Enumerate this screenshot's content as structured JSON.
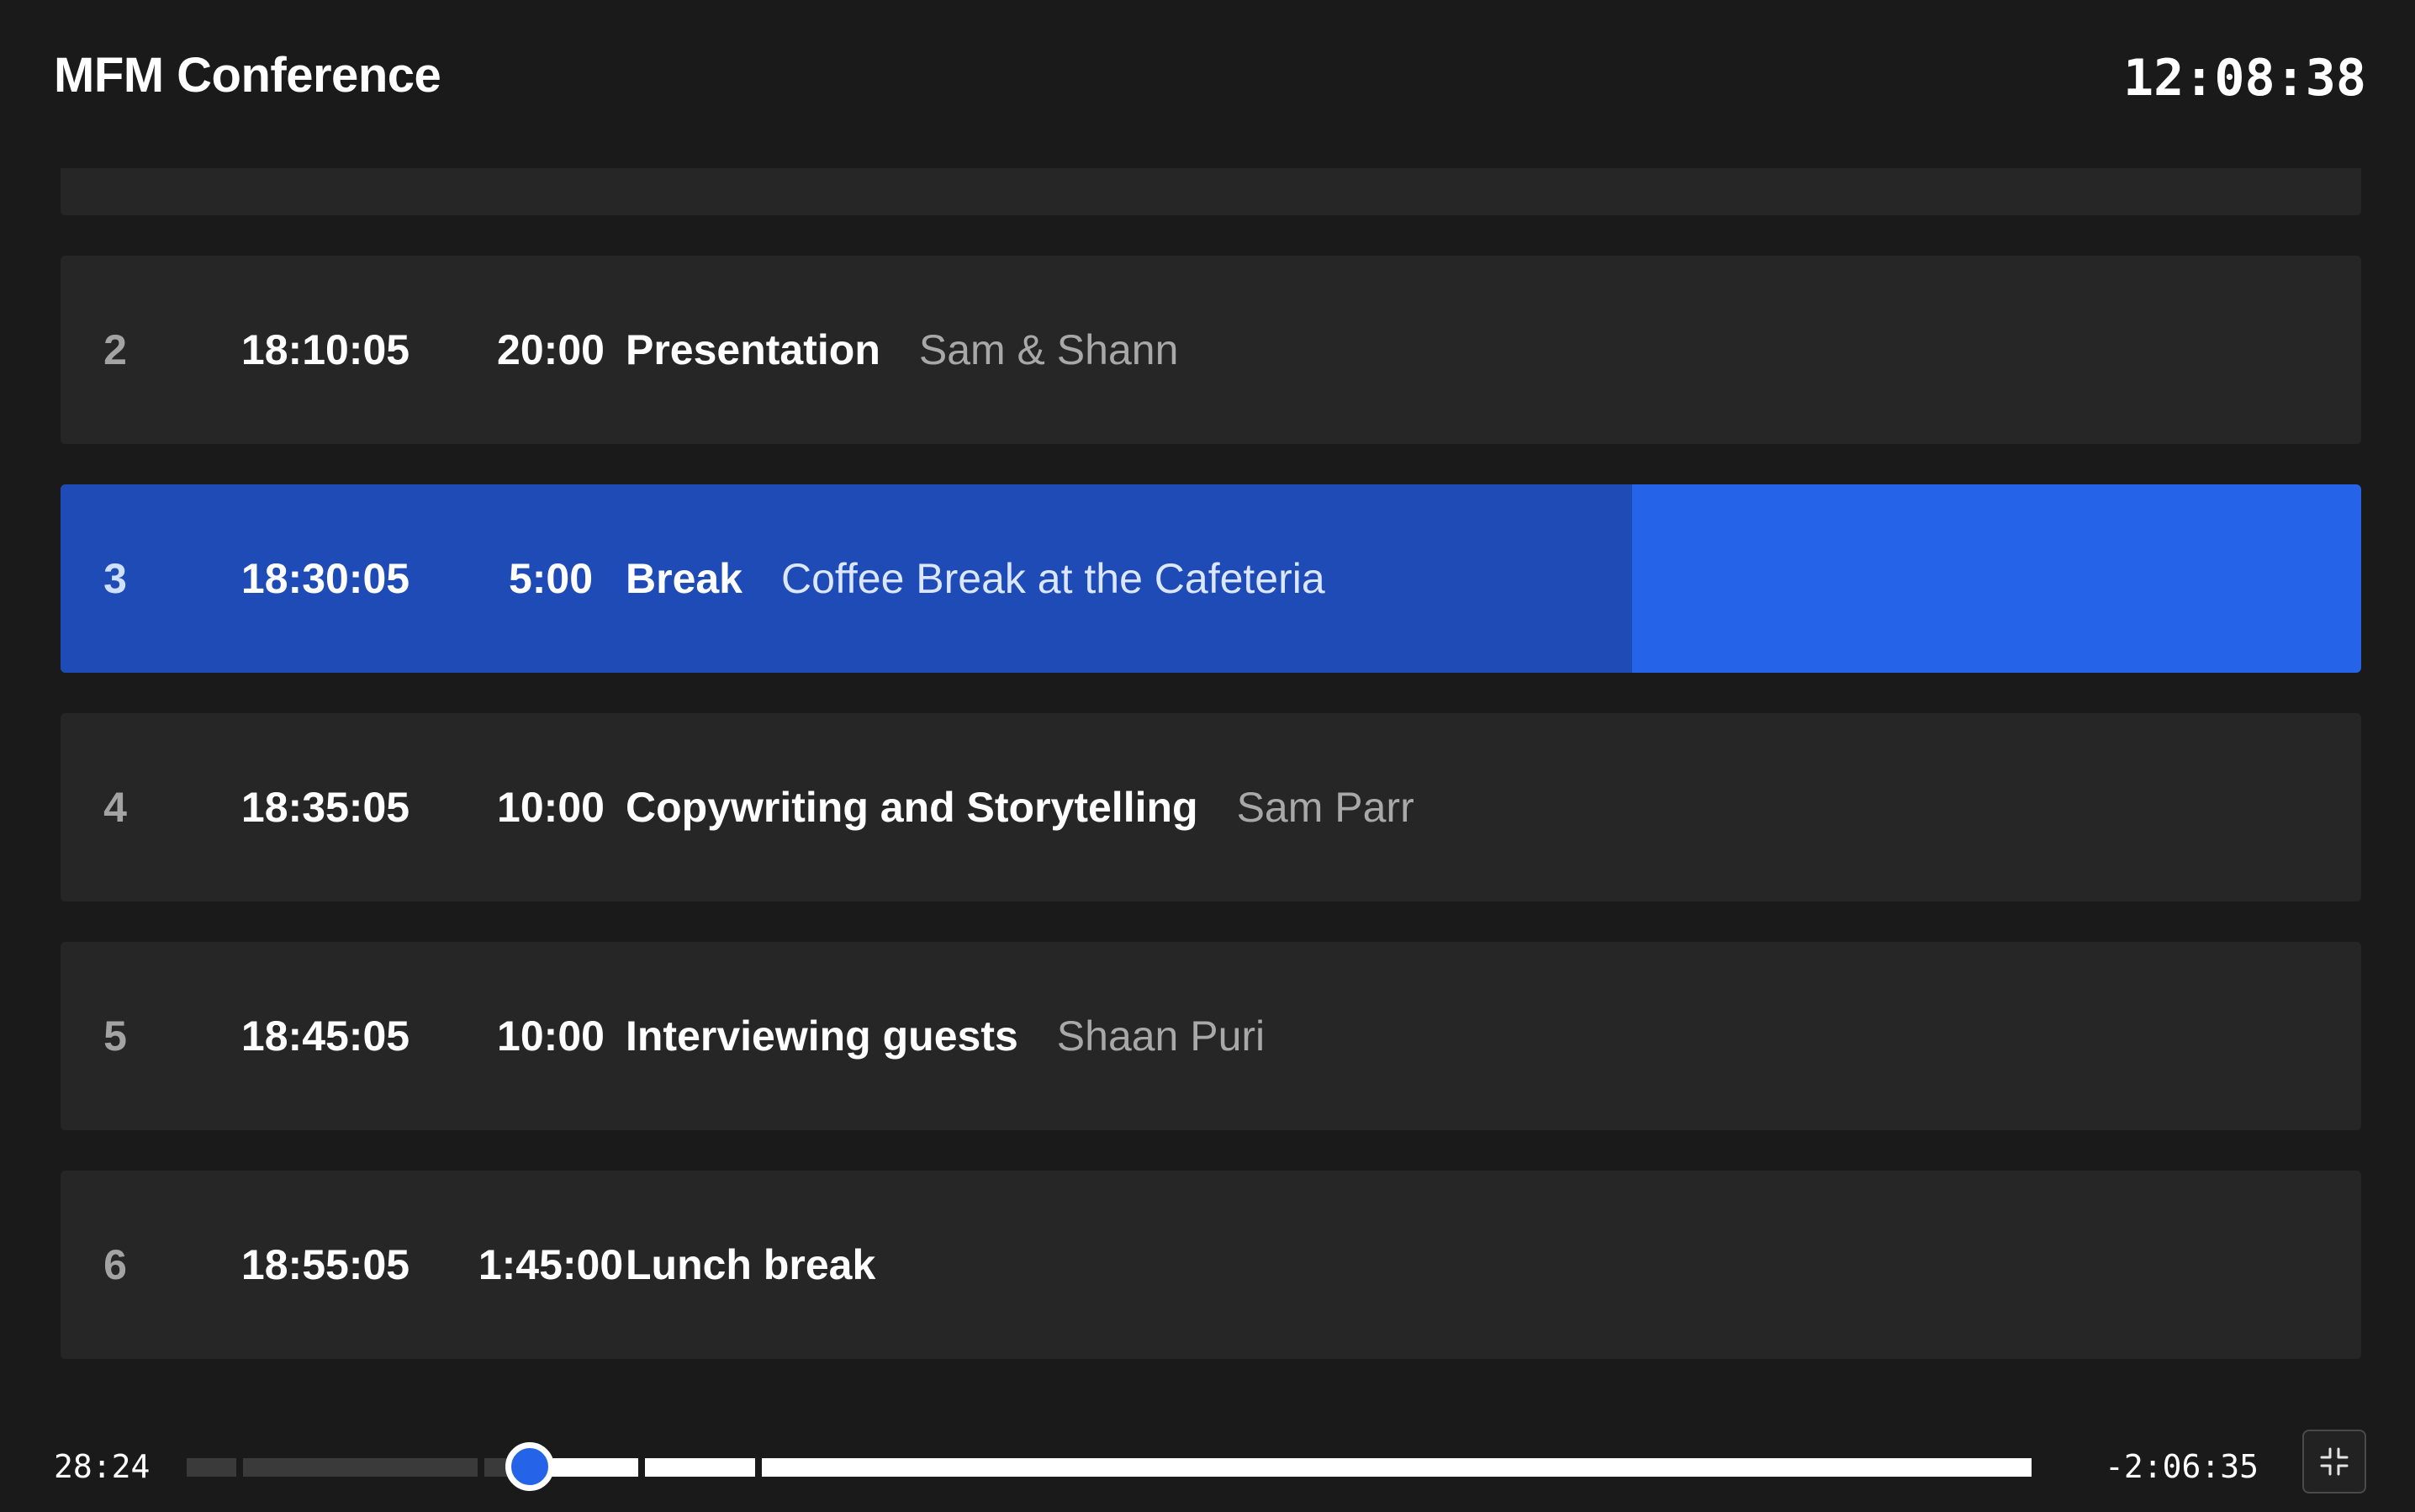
{
  "header": {
    "title": "MFM Conference",
    "clock": "12:08:38"
  },
  "rows": [
    {
      "index": "2",
      "start": "18:10:05",
      "duration": "20:00",
      "title": "Presentation",
      "subtitle": "Sam & Shann",
      "state": "upcoming"
    },
    {
      "index": "3",
      "start": "18:30:05",
      "duration": "5:00",
      "title": "Break",
      "subtitle": "Coffee Break at the Cafeteria",
      "state": "current",
      "progress": 0.683
    },
    {
      "index": "4",
      "start": "18:35:05",
      "duration": "10:00",
      "title": "Copywriting and Storytelling",
      "subtitle": "Sam Parr",
      "state": "upcoming"
    },
    {
      "index": "5",
      "start": "18:45:05",
      "duration": "10:00",
      "title": "Interviewing guests",
      "subtitle": "Shaan Puri",
      "state": "upcoming"
    },
    {
      "index": "6",
      "start": "18:55:05",
      "duration": "1:45:00",
      "title": "Lunch break",
      "subtitle": "",
      "state": "upcoming"
    }
  ],
  "timeline": {
    "elapsed": "28:24",
    "remaining": "-2:06:35",
    "position": 0.182,
    "segment_fractions": [
      0.03,
      0.128,
      0.02,
      0.065,
      0.062,
      0.677
    ]
  },
  "controls": {
    "collapse_icon": "collapse-icon"
  },
  "colors": {
    "background": "#1a1a1a",
    "row": "#262626",
    "current_row": "#2563e8",
    "current_progress": "#1e4bb5",
    "muted_text": "#a8a8a8",
    "accent": "#2563e8"
  }
}
